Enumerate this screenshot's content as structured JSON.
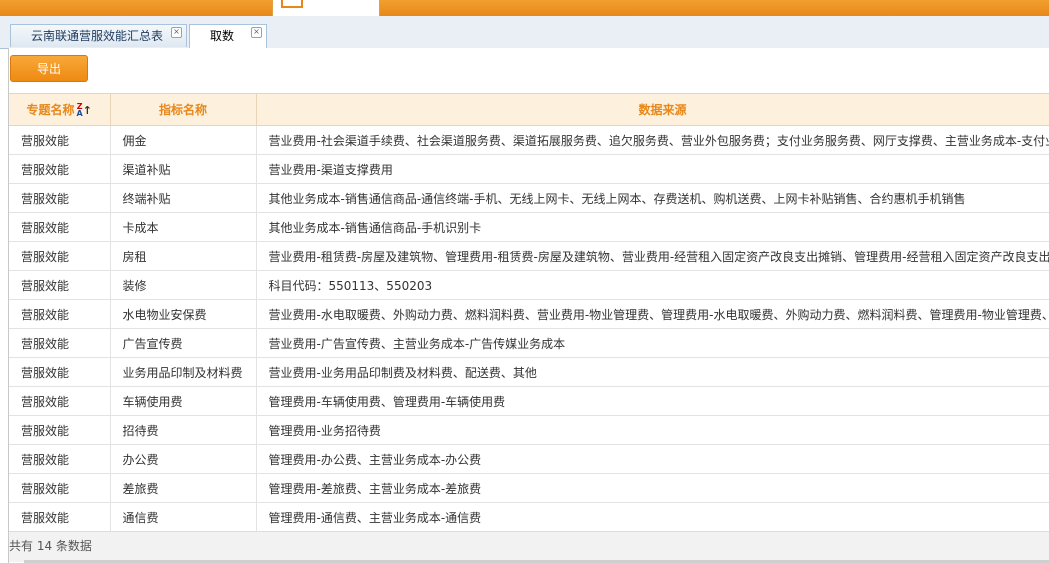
{
  "tabs": [
    {
      "label": "云南联通营服效能汇总表"
    },
    {
      "label": "取数规则"
    }
  ],
  "toolbar": {
    "export_label": "导出"
  },
  "table": {
    "headers": {
      "topic": "专题名称",
      "indicator": "指标名称",
      "source": "数据来源"
    },
    "sort_icon": {
      "top": "Z",
      "bottom": "A",
      "arrow": "↑"
    },
    "rows": [
      {
        "topic": "营服效能",
        "indicator": "佣金",
        "source": "营业费用-社会渠道手续费、社会渠道服务费、渠道拓展服务费、追欠服务费、营业外包服务费；支付业务服务费、网厅支撑费、主营业务成本-支付业"
      },
      {
        "topic": "营服效能",
        "indicator": "渠道补贴",
        "source": "营业费用-渠道支撑费用"
      },
      {
        "topic": "营服效能",
        "indicator": "终端补贴",
        "source": "其他业务成本-销售通信商品-通信终端-手机、无线上网卡、无线上网本、存费送机、购机送费、上网卡补贴销售、合约惠机手机销售"
      },
      {
        "topic": "营服效能",
        "indicator": "卡成本",
        "source": "其他业务成本-销售通信商品-手机识别卡"
      },
      {
        "topic": "营服效能",
        "indicator": "房租",
        "source": "营业费用-租赁费-房屋及建筑物、管理费用-租赁费-房屋及建筑物、营业费用-经营租入固定资产改良支出摊销、管理费用-经营租入固定资产改良支出"
      },
      {
        "topic": "营服效能",
        "indicator": "装修",
        "source": "科目代码：550113、550203"
      },
      {
        "topic": "营服效能",
        "indicator": "水电物业安保费",
        "source": "营业费用-水电取暖费、外购动力费、燃料润料费、营业费用-物业管理费、管理费用-水电取暖费、外购动力费、燃料润料费、管理费用-物业管理费、"
      },
      {
        "topic": "营服效能",
        "indicator": "广告宣传费",
        "source": "营业费用-广告宣传费、主营业务成本-广告传媒业务成本"
      },
      {
        "topic": "营服效能",
        "indicator": "业务用品印制及材料费",
        "source": "营业费用-业务用品印制费及材料费、配送费、其他"
      },
      {
        "topic": "营服效能",
        "indicator": "车辆使用费",
        "source": "管理费用-车辆使用费、管理费用-车辆使用费"
      },
      {
        "topic": "营服效能",
        "indicator": "招待费",
        "source": "管理费用-业务招待费"
      },
      {
        "topic": "营服效能",
        "indicator": "办公费",
        "source": "管理费用-办公费、主营业务成本-办公费"
      },
      {
        "topic": "营服效能",
        "indicator": "差旅费",
        "source": "管理费用-差旅费、主营业务成本-差旅费"
      },
      {
        "topic": "营服效能",
        "indicator": "通信费",
        "source": "管理费用-通信费、主营业务成本-通信费"
      }
    ]
  },
  "footer": {
    "summary": "共有 14 条数据"
  }
}
